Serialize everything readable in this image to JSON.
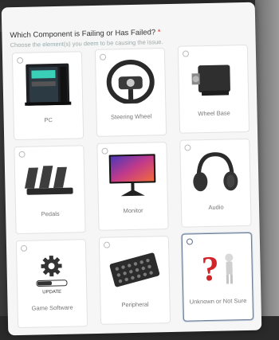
{
  "question": {
    "title": "Which Component is Failing or Has Failed?",
    "required_mark": "*",
    "subtitle": "Choose the element(s) you deem to be causing the issue."
  },
  "options": [
    {
      "label": "PC",
      "icon": "pc-case-icon",
      "selected": false
    },
    {
      "label": "Steering Wheel",
      "icon": "steering-wheel-icon",
      "selected": false
    },
    {
      "label": "Wheel Base",
      "icon": "wheel-base-icon",
      "selected": false
    },
    {
      "label": "Pedals",
      "icon": "pedals-icon",
      "selected": false
    },
    {
      "label": "Monitor",
      "icon": "monitor-icon",
      "selected": false
    },
    {
      "label": "Audio",
      "icon": "headphones-icon",
      "selected": false
    },
    {
      "label": "Game Software",
      "icon": "gear-icon",
      "selected": false
    },
    {
      "label": "Peripheral",
      "icon": "button-box-icon",
      "selected": false
    },
    {
      "label": "Unknown or Not Sure",
      "icon": "question-mark-icon",
      "selected": true
    }
  ],
  "game_software_caption": "UPDATE",
  "colors": {
    "selected_border": "#6a7d95",
    "required": "#dd3333",
    "question_mark": "#d0262b"
  }
}
